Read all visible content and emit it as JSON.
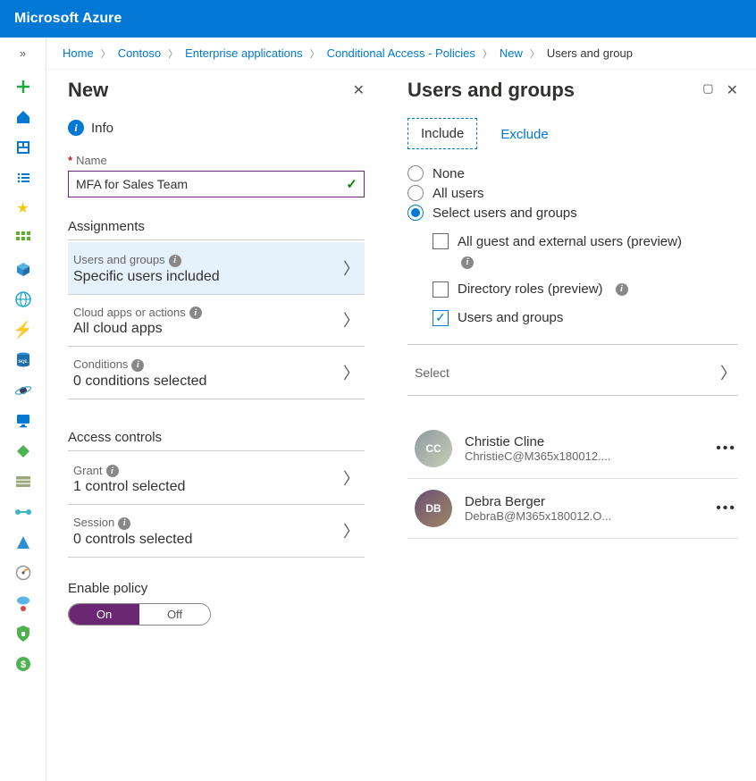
{
  "topbar": {
    "title": "Microsoft Azure"
  },
  "breadcrumb": {
    "items": [
      "Home",
      "Contoso",
      "Enterprise applications",
      "Conditional Access - Policies",
      "New"
    ],
    "current": "Users and group"
  },
  "panel_new": {
    "title": "New",
    "info_label": "Info",
    "name_label": "Name",
    "name_value": "MFA for Sales Team",
    "section_assignments": "Assignments",
    "rows": {
      "users": {
        "label": "Users and groups",
        "value": "Specific users included"
      },
      "cloud": {
        "label": "Cloud apps or actions",
        "value": "All cloud apps"
      },
      "cond": {
        "label": "Conditions",
        "value": "0 conditions selected"
      }
    },
    "section_access": "Access controls",
    "rows2": {
      "grant": {
        "label": "Grant",
        "value": "1 control selected"
      },
      "session": {
        "label": "Session",
        "value": "0 controls selected"
      }
    },
    "enable_label": "Enable policy",
    "toggle": {
      "on": "On",
      "off": "Off"
    }
  },
  "panel_users": {
    "title": "Users and groups",
    "tabs": {
      "include": "Include",
      "exclude": "Exclude"
    },
    "radios": {
      "none": "None",
      "all": "All users",
      "select": "Select users and groups"
    },
    "checks": {
      "guests": "All guest and external users (preview)",
      "droles": "Directory roles (preview)",
      "ugroups": "Users and groups"
    },
    "select_label": "Select",
    "users": [
      {
        "name": "Christie Cline",
        "email": "ChristieC@M365x180012...."
      },
      {
        "name": "Debra Berger",
        "email": "DebraB@M365x180012.O..."
      }
    ]
  }
}
